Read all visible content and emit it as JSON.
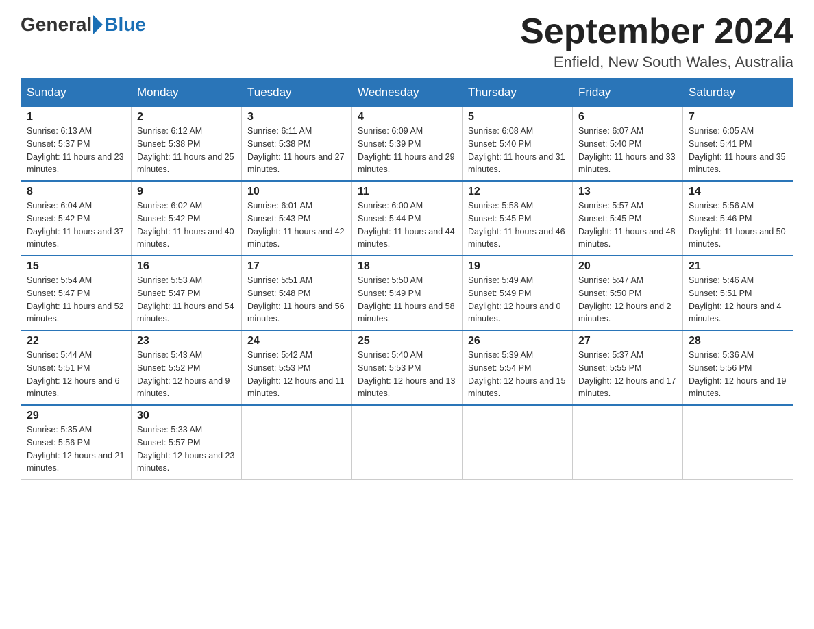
{
  "header": {
    "logo_general": "General",
    "logo_blue": "Blue",
    "month_year": "September 2024",
    "location": "Enfield, New South Wales, Australia"
  },
  "weekdays": [
    "Sunday",
    "Monday",
    "Tuesday",
    "Wednesday",
    "Thursday",
    "Friday",
    "Saturday"
  ],
  "weeks": [
    [
      {
        "day": "1",
        "sunrise": "6:13 AM",
        "sunset": "5:37 PM",
        "daylight": "11 hours and 23 minutes."
      },
      {
        "day": "2",
        "sunrise": "6:12 AM",
        "sunset": "5:38 PM",
        "daylight": "11 hours and 25 minutes."
      },
      {
        "day": "3",
        "sunrise": "6:11 AM",
        "sunset": "5:38 PM",
        "daylight": "11 hours and 27 minutes."
      },
      {
        "day": "4",
        "sunrise": "6:09 AM",
        "sunset": "5:39 PM",
        "daylight": "11 hours and 29 minutes."
      },
      {
        "day": "5",
        "sunrise": "6:08 AM",
        "sunset": "5:40 PM",
        "daylight": "11 hours and 31 minutes."
      },
      {
        "day": "6",
        "sunrise": "6:07 AM",
        "sunset": "5:40 PM",
        "daylight": "11 hours and 33 minutes."
      },
      {
        "day": "7",
        "sunrise": "6:05 AM",
        "sunset": "5:41 PM",
        "daylight": "11 hours and 35 minutes."
      }
    ],
    [
      {
        "day": "8",
        "sunrise": "6:04 AM",
        "sunset": "5:42 PM",
        "daylight": "11 hours and 37 minutes."
      },
      {
        "day": "9",
        "sunrise": "6:02 AM",
        "sunset": "5:42 PM",
        "daylight": "11 hours and 40 minutes."
      },
      {
        "day": "10",
        "sunrise": "6:01 AM",
        "sunset": "5:43 PM",
        "daylight": "11 hours and 42 minutes."
      },
      {
        "day": "11",
        "sunrise": "6:00 AM",
        "sunset": "5:44 PM",
        "daylight": "11 hours and 44 minutes."
      },
      {
        "day": "12",
        "sunrise": "5:58 AM",
        "sunset": "5:45 PM",
        "daylight": "11 hours and 46 minutes."
      },
      {
        "day": "13",
        "sunrise": "5:57 AM",
        "sunset": "5:45 PM",
        "daylight": "11 hours and 48 minutes."
      },
      {
        "day": "14",
        "sunrise": "5:56 AM",
        "sunset": "5:46 PM",
        "daylight": "11 hours and 50 minutes."
      }
    ],
    [
      {
        "day": "15",
        "sunrise": "5:54 AM",
        "sunset": "5:47 PM",
        "daylight": "11 hours and 52 minutes."
      },
      {
        "day": "16",
        "sunrise": "5:53 AM",
        "sunset": "5:47 PM",
        "daylight": "11 hours and 54 minutes."
      },
      {
        "day": "17",
        "sunrise": "5:51 AM",
        "sunset": "5:48 PM",
        "daylight": "11 hours and 56 minutes."
      },
      {
        "day": "18",
        "sunrise": "5:50 AM",
        "sunset": "5:49 PM",
        "daylight": "11 hours and 58 minutes."
      },
      {
        "day": "19",
        "sunrise": "5:49 AM",
        "sunset": "5:49 PM",
        "daylight": "12 hours and 0 minutes."
      },
      {
        "day": "20",
        "sunrise": "5:47 AM",
        "sunset": "5:50 PM",
        "daylight": "12 hours and 2 minutes."
      },
      {
        "day": "21",
        "sunrise": "5:46 AM",
        "sunset": "5:51 PM",
        "daylight": "12 hours and 4 minutes."
      }
    ],
    [
      {
        "day": "22",
        "sunrise": "5:44 AM",
        "sunset": "5:51 PM",
        "daylight": "12 hours and 6 minutes."
      },
      {
        "day": "23",
        "sunrise": "5:43 AM",
        "sunset": "5:52 PM",
        "daylight": "12 hours and 9 minutes."
      },
      {
        "day": "24",
        "sunrise": "5:42 AM",
        "sunset": "5:53 PM",
        "daylight": "12 hours and 11 minutes."
      },
      {
        "day": "25",
        "sunrise": "5:40 AM",
        "sunset": "5:53 PM",
        "daylight": "12 hours and 13 minutes."
      },
      {
        "day": "26",
        "sunrise": "5:39 AM",
        "sunset": "5:54 PM",
        "daylight": "12 hours and 15 minutes."
      },
      {
        "day": "27",
        "sunrise": "5:37 AM",
        "sunset": "5:55 PM",
        "daylight": "12 hours and 17 minutes."
      },
      {
        "day": "28",
        "sunrise": "5:36 AM",
        "sunset": "5:56 PM",
        "daylight": "12 hours and 19 minutes."
      }
    ],
    [
      {
        "day": "29",
        "sunrise": "5:35 AM",
        "sunset": "5:56 PM",
        "daylight": "12 hours and 21 minutes."
      },
      {
        "day": "30",
        "sunrise": "5:33 AM",
        "sunset": "5:57 PM",
        "daylight": "12 hours and 23 minutes."
      },
      null,
      null,
      null,
      null,
      null
    ]
  ]
}
